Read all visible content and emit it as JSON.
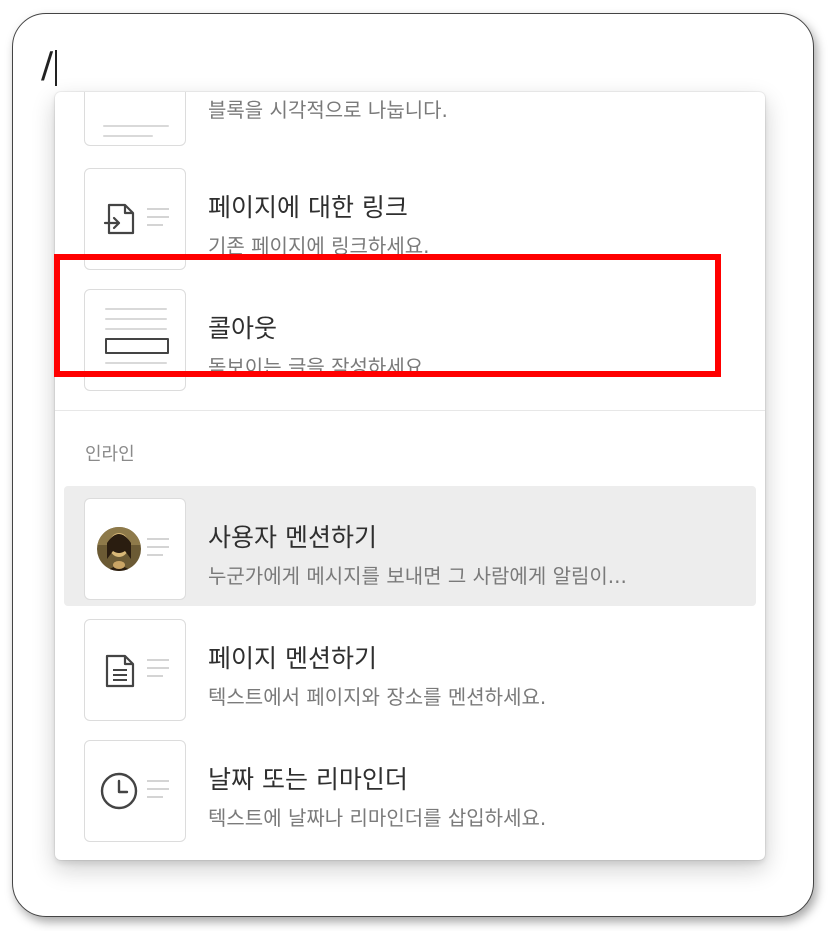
{
  "editor": {
    "typed_text": "/"
  },
  "menu": {
    "partial_top_item": {
      "desc": "블록을 시각적으로 나눕니다.",
      "icon": "divider-icon"
    },
    "items_top": [
      {
        "title": "페이지에 대한 링크",
        "desc": "기존 페이지에 링크하세요.",
        "icon": "page-link-icon"
      },
      {
        "title": "콜아웃",
        "desc": "돋보이는 글을 작성하세요.",
        "icon": "callout-icon"
      }
    ],
    "section_inline": {
      "label": "인라인"
    },
    "items_inline": [
      {
        "title": "사용자 멘션하기",
        "desc": "누군가에게 메시지를 보내면 그 사람에게 알림이...",
        "icon": "avatar-icon"
      },
      {
        "title": "페이지 멘션하기",
        "desc": "텍스트에서 페이지와 장소를 멘션하세요.",
        "icon": "page-icon"
      },
      {
        "title": "날짜 또는 리마인더",
        "desc": "텍스트에 날짜나 리마인더를 삽입하세요.",
        "icon": "clock-icon"
      }
    ]
  },
  "annotation": {
    "highlight_color": "#ff0000"
  }
}
